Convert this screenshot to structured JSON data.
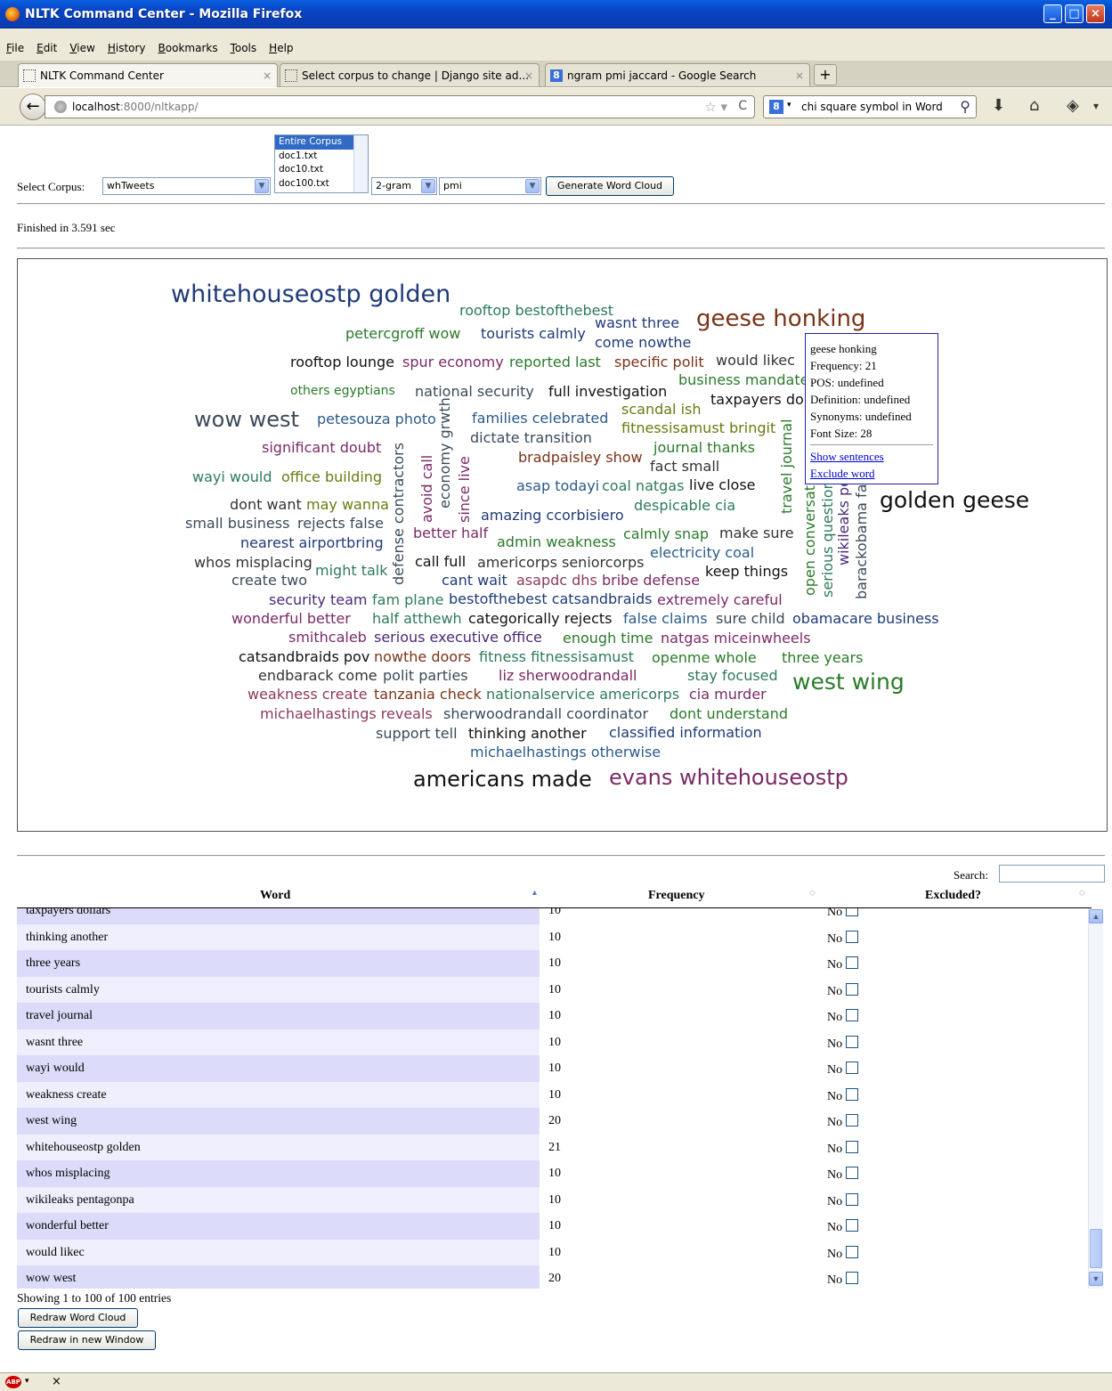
{
  "window": {
    "title": "NLTK Command Center - Mozilla Firefox"
  },
  "menu": [
    "File",
    "Edit",
    "View",
    "History",
    "Bookmarks",
    "Tools",
    "Help"
  ],
  "tabs": [
    {
      "label": "NLTK Command Center"
    },
    {
      "label": "Select corpus to change | Django site ad..."
    },
    {
      "label": "ngram pmi jaccard - Google Search"
    }
  ],
  "address": {
    "host": "localhost",
    "path": ":8000/nltkapp/"
  },
  "search_bar": {
    "query": "chi square symbol in Word"
  },
  "form": {
    "select_corpus_label": "Select Corpus:",
    "corpus_value": "whTweets",
    "docs": [
      "Entire Corpus",
      "doc1.txt",
      "doc10.txt",
      "doc100.txt"
    ],
    "ngram_value": "2-gram",
    "measure_value": "pmi",
    "generate_label": "Generate Word Cloud"
  },
  "status": {
    "finished": "Finished in 3.591 sec"
  },
  "cloud": {
    "colors": {
      "navy": "#1f3a78",
      "teal": "#2e7a5a",
      "plum": "#7a2a66",
      "brown": "#7a3318",
      "olive": "#6a7a10",
      "green": "#2a7a2a",
      "slate": "#3a4a5a",
      "black": "#111111",
      "dark": "#333333",
      "purple": "#4a2a78",
      "rose": "#8a3a5a",
      "steel": "#2a5a8a"
    },
    "words": [
      {
        "t": "whitehouseostp golden",
        "c": "navy"
      },
      {
        "t": "rooftop bestofthebest",
        "c": "teal"
      },
      {
        "t": "wasnt three",
        "c": "navy"
      },
      {
        "t": "geese honking",
        "c": "brown"
      },
      {
        "t": "petercgroff wow",
        "c": "green"
      },
      {
        "t": "tourists calmly",
        "c": "navy"
      },
      {
        "t": "come nowthe",
        "c": "navy"
      },
      {
        "t": "rooftop lounge",
        "c": "black"
      },
      {
        "t": "spur economy",
        "c": "plum"
      },
      {
        "t": "reported last",
        "c": "green"
      },
      {
        "t": "specific polit",
        "c": "brown"
      },
      {
        "t": "would likec",
        "c": "dark"
      },
      {
        "t": "business mandate",
        "c": "green"
      },
      {
        "t": "others egyptians",
        "c": "green"
      },
      {
        "t": "national security",
        "c": "slate"
      },
      {
        "t": "full investigation",
        "c": "black"
      },
      {
        "t": "taxpayers dol",
        "c": "black"
      },
      {
        "t": "scandal ish",
        "c": "olive"
      },
      {
        "t": "wow west",
        "c": "slate"
      },
      {
        "t": "petesouza photo",
        "c": "steel"
      },
      {
        "t": "families celebrated",
        "c": "steel"
      },
      {
        "t": "fitnessisamust bringit",
        "c": "olive"
      },
      {
        "t": "dictate transition",
        "c": "slate"
      },
      {
        "t": "significant doubt",
        "c": "plum"
      },
      {
        "t": "journal thanks",
        "c": "green"
      },
      {
        "t": "bradpaisley show",
        "c": "brown"
      },
      {
        "t": "fact small",
        "c": "dark"
      },
      {
        "t": "wayi would",
        "c": "teal"
      },
      {
        "t": "office building",
        "c": "olive"
      },
      {
        "t": "asap todayi",
        "c": "steel"
      },
      {
        "t": "coal natgas",
        "c": "teal"
      },
      {
        "t": "live close",
        "c": "black"
      },
      {
        "t": "dont want",
        "c": "dark"
      },
      {
        "t": "may wanna",
        "c": "olive"
      },
      {
        "t": "despicable cia",
        "c": "teal"
      },
      {
        "t": "golden geese",
        "c": "black"
      },
      {
        "t": "amazing ccorbisiero",
        "c": "navy"
      },
      {
        "t": "small business",
        "c": "slate"
      },
      {
        "t": "rejects false",
        "c": "slate"
      },
      {
        "t": "better half",
        "c": "plum"
      },
      {
        "t": "calmly snap",
        "c": "green"
      },
      {
        "t": "make sure",
        "c": "dark"
      },
      {
        "t": "nearest airportbring",
        "c": "navy"
      },
      {
        "t": "admin weakness",
        "c": "green"
      },
      {
        "t": "electricity coal",
        "c": "steel"
      },
      {
        "t": "whos misplacing",
        "c": "dark"
      },
      {
        "t": "might talk",
        "c": "teal"
      },
      {
        "t": "call full",
        "c": "black"
      },
      {
        "t": "americorps seniorcorps",
        "c": "dark"
      },
      {
        "t": "create two",
        "c": "slate"
      },
      {
        "t": "cant wait",
        "c": "navy"
      },
      {
        "t": "asapdc dhs",
        "c": "rose"
      },
      {
        "t": "bribe defense",
        "c": "plum"
      },
      {
        "t": "keep things",
        "c": "black"
      },
      {
        "t": "security team",
        "c": "purple"
      },
      {
        "t": "fam plane",
        "c": "teal"
      },
      {
        "t": "bestofthebest catsandbraids",
        "c": "navy"
      },
      {
        "t": "extremely careful",
        "c": "plum"
      },
      {
        "t": "wonderful better",
        "c": "plum"
      },
      {
        "t": "half atthewh",
        "c": "teal"
      },
      {
        "t": "categorically rejects",
        "c": "black"
      },
      {
        "t": "false claims",
        "c": "steel"
      },
      {
        "t": "sure child",
        "c": "slate"
      },
      {
        "t": "obamacare business",
        "c": "navy"
      },
      {
        "t": "smithcaleb",
        "c": "plum"
      },
      {
        "t": "serious executive office",
        "c": "purple"
      },
      {
        "t": "enough time",
        "c": "green"
      },
      {
        "t": "natgas miceinwheels",
        "c": "plum"
      },
      {
        "t": "catsandbraids pov",
        "c": "black"
      },
      {
        "t": "nowthe doors",
        "c": "brown"
      },
      {
        "t": "fitness fitnessisamust",
        "c": "teal"
      },
      {
        "t": "openme whole",
        "c": "green"
      },
      {
        "t": "three years",
        "c": "green"
      },
      {
        "t": "endbarack come",
        "c": "dark"
      },
      {
        "t": "polit parties",
        "c": "slate"
      },
      {
        "t": "liz sherwoodrandall",
        "c": "plum"
      },
      {
        "t": "stay focused",
        "c": "teal"
      },
      {
        "t": "west wing",
        "c": "green"
      },
      {
        "t": "weakness create",
        "c": "rose"
      },
      {
        "t": "tanzania check",
        "c": "brown"
      },
      {
        "t": "nationalservice americorps",
        "c": "teal"
      },
      {
        "t": "cia murder",
        "c": "plum"
      },
      {
        "t": "michaelhastings reveals",
        "c": "rose"
      },
      {
        "t": "sherwoodrandall coordinator",
        "c": "slate"
      },
      {
        "t": "dont understand",
        "c": "green"
      },
      {
        "t": "support tell",
        "c": "slate"
      },
      {
        "t": "thinking another",
        "c": "black"
      },
      {
        "t": "classified information",
        "c": "navy"
      },
      {
        "t": "michaelhastings otherwise",
        "c": "steel"
      },
      {
        "t": "americans made",
        "c": "black"
      },
      {
        "t": "evans whitehouseostp",
        "c": "plum"
      },
      {
        "t": "defense contractors",
        "c": "slate"
      },
      {
        "t": "avoid call",
        "c": "plum"
      },
      {
        "t": "economy grwth",
        "c": "slate"
      },
      {
        "t": "since live",
        "c": "plum"
      },
      {
        "t": "travel journal",
        "c": "green"
      },
      {
        "t": "open conversat",
        "c": "green"
      },
      {
        "t": "serious question",
        "c": "teal"
      },
      {
        "t": "wikileaks penta",
        "c": "purple"
      },
      {
        "t": "barackobama fa",
        "c": "slate"
      }
    ]
  },
  "popup": {
    "word": "geese honking",
    "frequency": "Frequency: 21",
    "pos": "POS: undefined",
    "definition": "Definition: undefined",
    "synonyms": "Synonyms: undefined",
    "font_size": "Font Size: 28",
    "show_sentences": "Show sentences",
    "exclude_word": "Exclude word"
  },
  "table": {
    "search_label": "Search:",
    "headers": {
      "word": "Word",
      "frequency": "Frequency",
      "excluded": "Excluded?"
    },
    "excluded_no": "No",
    "rows": [
      {
        "word": "taxpayers dollars",
        "freq": "10"
      },
      {
        "word": "thinking another",
        "freq": "10"
      },
      {
        "word": "three years",
        "freq": "10"
      },
      {
        "word": "tourists calmly",
        "freq": "10"
      },
      {
        "word": "travel journal",
        "freq": "10"
      },
      {
        "word": "wasnt three",
        "freq": "10"
      },
      {
        "word": "wayi would",
        "freq": "10"
      },
      {
        "word": "weakness create",
        "freq": "10"
      },
      {
        "word": "west wing",
        "freq": "20"
      },
      {
        "word": "whitehouseostp golden",
        "freq": "21"
      },
      {
        "word": "whos misplacing",
        "freq": "10"
      },
      {
        "word": "wikileaks pentagonpa",
        "freq": "10"
      },
      {
        "word": "wonderful better",
        "freq": "10"
      },
      {
        "word": "would likec",
        "freq": "10"
      },
      {
        "word": "wow west",
        "freq": "20"
      }
    ],
    "info": "Showing 1 to 100 of 100 entries"
  },
  "buttons": {
    "redraw": "Redraw Word Cloud",
    "redraw_new": "Redraw in new Window"
  }
}
